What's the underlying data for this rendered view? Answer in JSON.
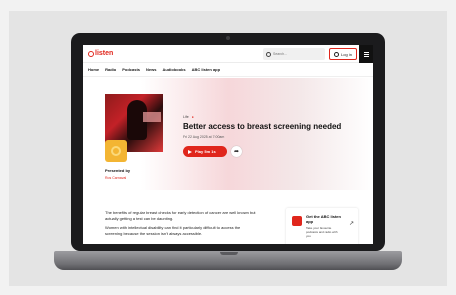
{
  "site": {
    "logo_text": "listen",
    "search_placeholder": "Search...",
    "login_label": "Log in",
    "nav": [
      "Home",
      "Radio",
      "Podcasts",
      "News",
      "Audiobooks",
      "ABC listen app"
    ]
  },
  "episode": {
    "kicker": "Life",
    "title": "Better access to breast screening needed",
    "date": "Fri 22 Aug 2025 at 7:00am",
    "play_label": "Play 5m 1s",
    "presented_by_label": "Presented by",
    "presenter": "Ros Carnaval",
    "paragraphs": [
      "The benefits of regular breast checks for early detection of cancer are well known but actually getting a test can be daunting.",
      "Women with intellectual disability can find it particularly difficult to access the screening because the session isn't always accessible."
    ]
  },
  "app_promo": {
    "title": "Get the ABC listen app",
    "subtitle": "Take your favourite podcasts and radio with you"
  },
  "colors": {
    "brand_red": "#e0261c"
  }
}
